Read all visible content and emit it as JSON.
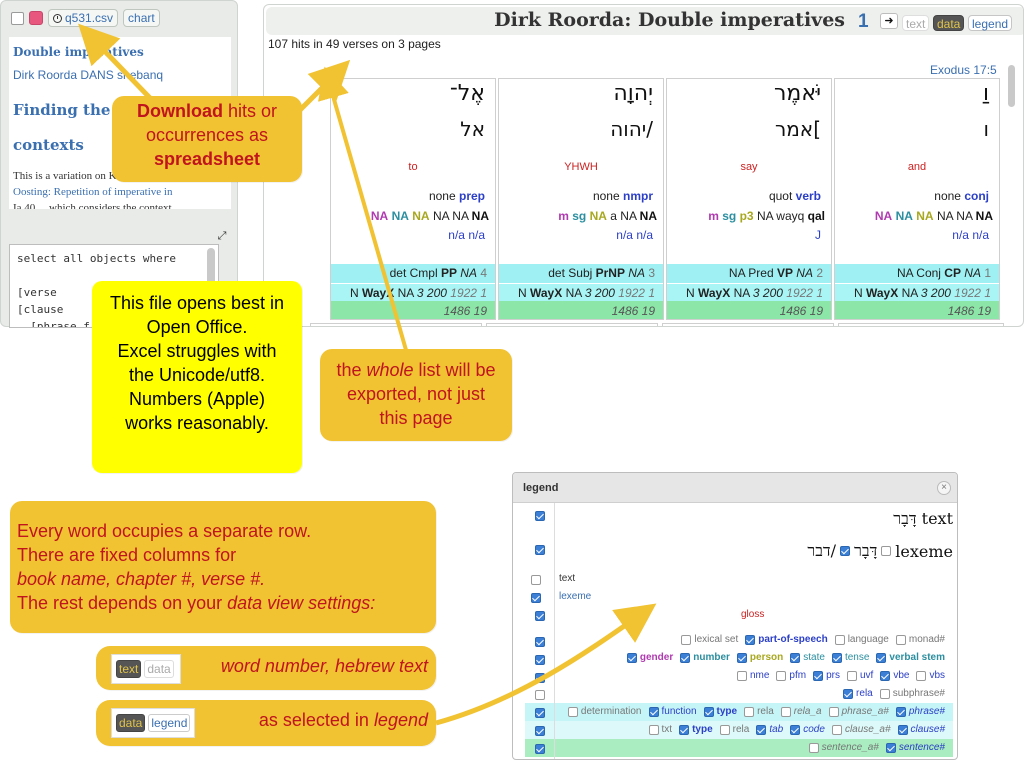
{
  "left_panel": {
    "csv_label": "q531.csv",
    "chart_label": "chart",
    "query_title": "Double imperatives",
    "author": "Dirk Roorda DANS shebanq",
    "heading_line1": "Finding the r",
    "heading_line2": "contexts",
    "body_line1": "This is a variation on Kemodt",
    "body_line2": "Oosting: Repetition of imperative in",
    "body_line3": "Ia 40 ... which considers the context",
    "query_text": "select all objects where\n\n[verse\n[clause\n  [phrase f"
  },
  "results": {
    "title": "Dirk Roorda: Double imperatives",
    "page_number": "1",
    "next_label": "➜",
    "tab_text": "text",
    "tab_data": "data",
    "tab_legend": "legend",
    "hits_summary": "107 hits in 49 verses on 3 pages",
    "verse_ref": "Exodus 17:5",
    "words": [
      {
        "hebrew": "אֶל־",
        "lexeme": "אל",
        "gloss": "to",
        "pos_plain": "none",
        "pos_bold": "prep",
        "morph": [
          [
            "NA",
            "#b03ab0"
          ],
          [
            "NA",
            "#2b8fa0"
          ],
          [
            "NA",
            "#a8a820"
          ],
          [
            "NA",
            "#222"
          ],
          [
            "NA",
            "#222"
          ],
          [
            "NA",
            "#111"
          ]
        ],
        "extra": "n/a  n/a",
        "phrase": [
          "det Cmpl ",
          "PP",
          " NA",
          " 4"
        ],
        "clause": [
          "N ",
          "WayX",
          " NA ",
          "3 200",
          " 1922 1"
        ],
        "sentence": "1486 19"
      },
      {
        "hebrew": "יְהוָה",
        "lexeme": "יהוה/",
        "gloss": "YHWH",
        "pos_plain": "none",
        "pos_bold": "nmpr",
        "morph": [
          [
            "m",
            "#b03ab0"
          ],
          [
            "sg",
            "#2b8fa0"
          ],
          [
            "NA",
            "#a8a820"
          ],
          [
            "a",
            "#222"
          ],
          [
            "NA",
            "#222"
          ],
          [
            "NA",
            "#111"
          ]
        ],
        "extra": "n/a  n/a",
        "phrase": [
          "det Subj ",
          "PrNP",
          " NA",
          " 3"
        ],
        "clause": [
          "N ",
          "WayX",
          " NA ",
          "3 200",
          " 1922 1"
        ],
        "sentence": "1486 19"
      },
      {
        "hebrew": "יֹּאמֶר",
        "lexeme": "אמר[",
        "gloss": "say",
        "pos_plain": "quot",
        "pos_bold": "verb",
        "morph": [
          [
            "m",
            "#b03ab0"
          ],
          [
            "sg",
            "#2b8fa0"
          ],
          [
            "p3",
            "#a8a820"
          ],
          [
            "NA",
            "#222"
          ],
          [
            "wayq",
            "#222"
          ],
          [
            "qal",
            "#111"
          ]
        ],
        "extra": "J",
        "phrase": [
          "NA Pred ",
          "VP",
          " NA",
          " 2"
        ],
        "clause": [
          "N ",
          "WayX",
          " NA ",
          "3 200",
          " 1922 1"
        ],
        "sentence": "1486 19"
      },
      {
        "hebrew": "וַ",
        "lexeme": "ו",
        "gloss": "and",
        "pos_plain": "none",
        "pos_bold": "conj",
        "morph": [
          [
            "NA",
            "#b03ab0"
          ],
          [
            "NA",
            "#2b8fa0"
          ],
          [
            "NA",
            "#a8a820"
          ],
          [
            "NA",
            "#222"
          ],
          [
            "NA",
            "#222"
          ],
          [
            "NA",
            "#111"
          ]
        ],
        "extra": "n/a  n/a",
        "phrase": [
          "NA Conj ",
          "CP",
          " NA",
          " 1"
        ],
        "clause": [
          "N ",
          "WayX",
          " NA ",
          "3 200",
          " 1922 1"
        ],
        "sentence": "1486 19"
      }
    ]
  },
  "callouts": {
    "download_bold": "Download",
    "download_rest1": " hits or",
    "download_line2": "occurrences as",
    "download_line3": "spreadsheet",
    "opens_lines": [
      "This file opens best in",
      "Open Office.",
      "Excel struggles with",
      "the Unicode/utf8.",
      "Numbers (Apple)",
      "works reasonably."
    ],
    "whole_pre": "the ",
    "whole_it": "whole",
    "whole_post": " list will be",
    "whole_line2": "exported, not just",
    "whole_line3": "this page",
    "every_line1": "Every word occupies a separate row.",
    "every_line2": "There are fixed columns for",
    "every_line3": "book name, chapter #, verse #.",
    "every_line4_pre": "The rest depends on your ",
    "every_line4_it": "data view settings:",
    "row1_tab_a": "text",
    "row1_tab_b": "data",
    "row1_label": "word number, hebrew text",
    "row2_tab_a": "data",
    "row2_tab_b": "legend",
    "row2_pre": "as selected in ",
    "row2_it": "legend"
  },
  "legend": {
    "title": "legend",
    "close": "×",
    "text_heb": "דָּבָר",
    "text_label": "text",
    "lexeme_heb1": "דָּבָר",
    "lexeme_heb2": "דבר/",
    "lexeme_label": "lexeme",
    "row_text": "text",
    "row_lexeme": "lexeme",
    "gloss": "gloss",
    "opts_row1": [
      "lexical set",
      "part-of-speech",
      "language",
      "monad#"
    ],
    "opts_row2": [
      "gender",
      "number",
      "person",
      "state",
      "tense",
      "verbal stem"
    ],
    "opts_row3": [
      "nme",
      "pfm",
      "prs",
      "uvf",
      "vbe",
      "vbs"
    ],
    "opts_row4": [
      "rela",
      "subphrase#"
    ],
    "opts_row5": [
      "determination",
      "function",
      "type",
      "rela",
      "rela_a",
      "phrase_a#",
      "phrase#"
    ],
    "opts_row6": [
      "txt",
      "type",
      "rela",
      "tab",
      "code",
      "clause_a#",
      "clause#"
    ],
    "opts_row7": [
      "sentence_a#",
      "sentence#"
    ]
  },
  "colors": {
    "accent_blue": "#3a6fb0",
    "callout_orange": "#f1c232",
    "callout_yellow": "#ffff00",
    "callout_text_red": "#c0141e",
    "phrase_band": "#9ff0f3",
    "sentence_band": "#8ce6a8"
  }
}
